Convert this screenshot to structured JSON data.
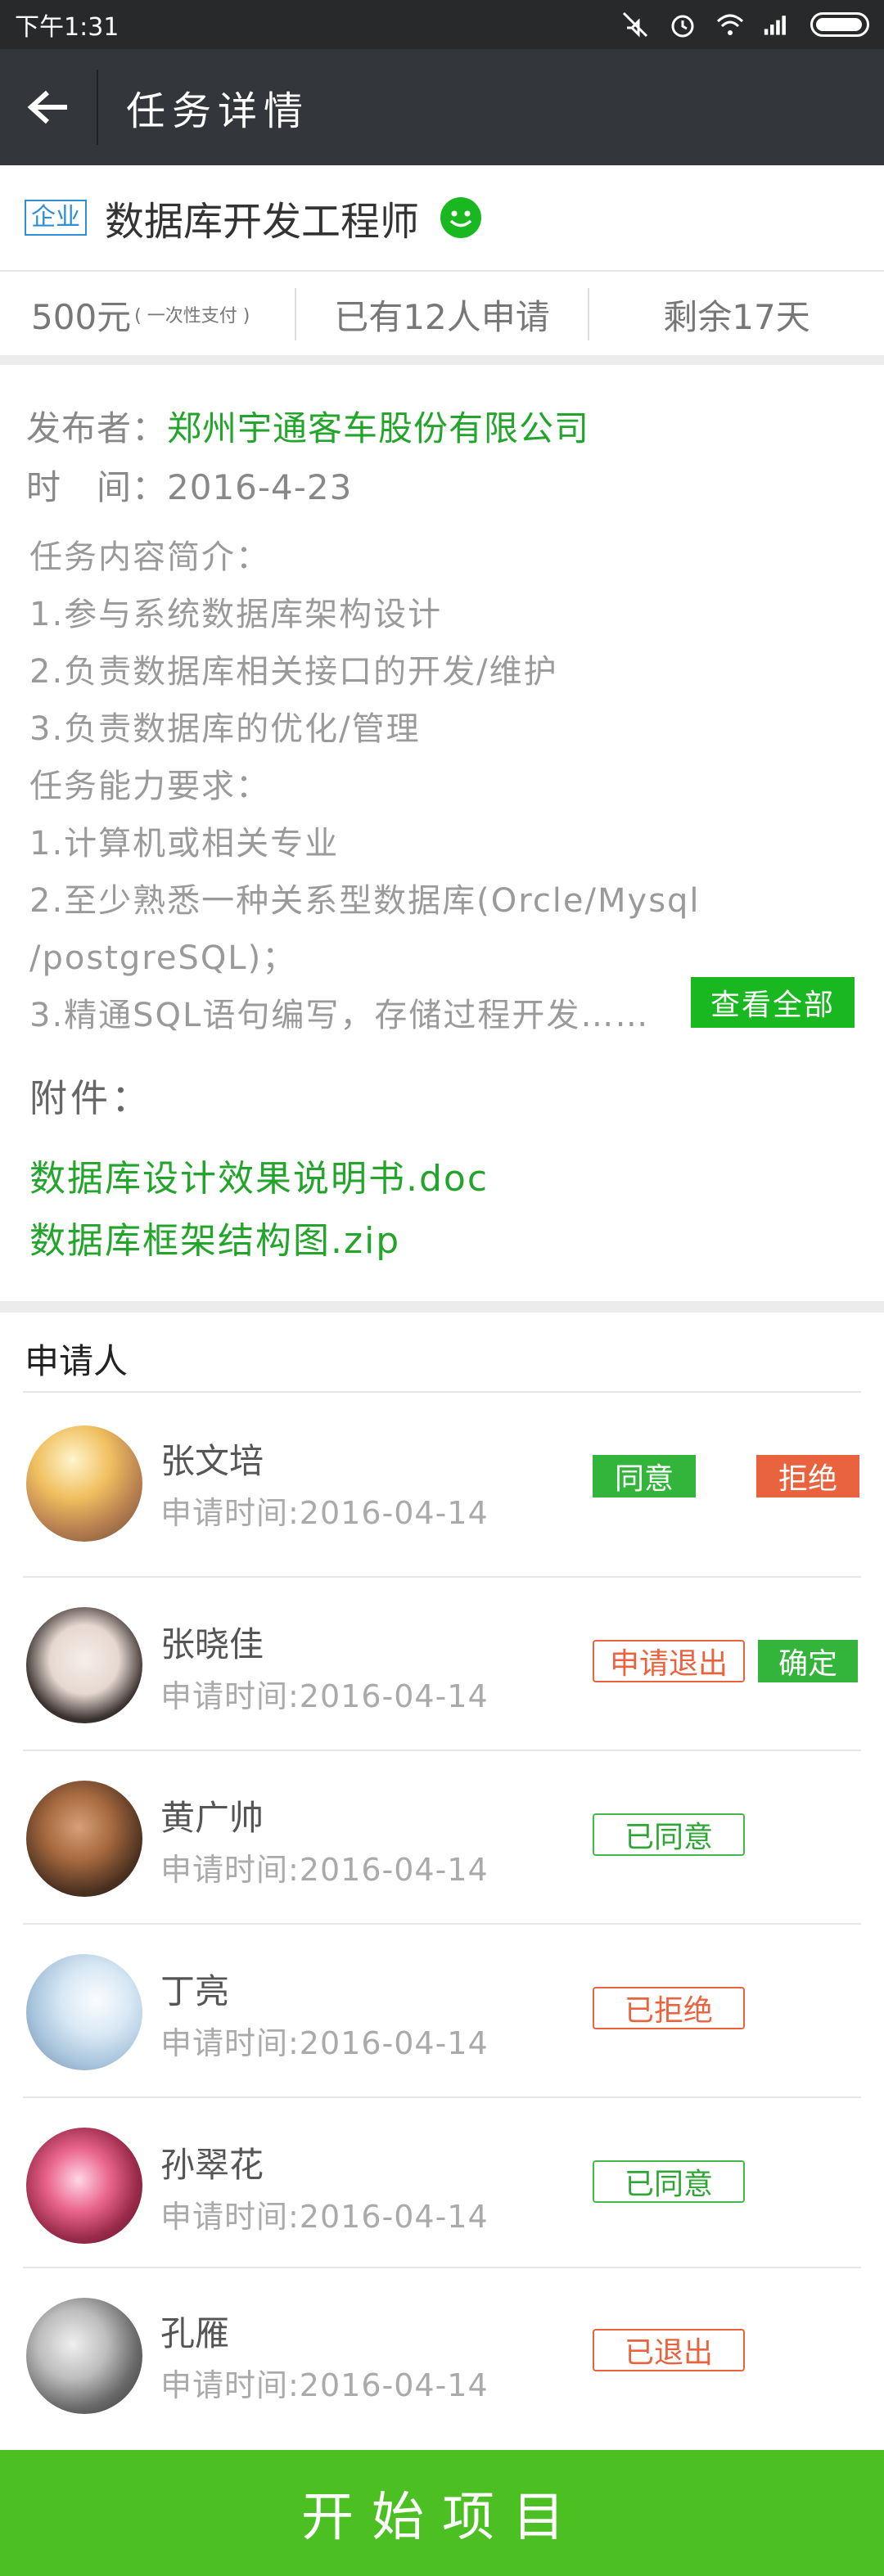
{
  "status_bar": {
    "time": "下午1:31"
  },
  "nav": {
    "title": "任务详情"
  },
  "task": {
    "badge": "企业",
    "title": "数据库开发工程师",
    "price": "500元",
    "price_note": "( 一次性支付 )",
    "applicants_count": "已有12人申请",
    "remaining": "剩余17天"
  },
  "details": {
    "publisher_label": "发布者：",
    "publisher": "郑州宇通客车股份有限公司",
    "time_label": "时　间：",
    "time": "2016-4-23",
    "lines": [
      "任务内容简介：",
      "1.参与系统数据库架构设计",
      "2.负责数据库相关接口的开发/维护",
      "3.负责数据库的优化/管理",
      "任务能力要求：",
      "1.计算机或相关专业",
      "2.至少熟悉一种关系型数据库(Orcle/Mysql",
      "/postgreSQL)；",
      "3.精通SQL语句编写，存储过程开发……"
    ],
    "view_all": "查看全部",
    "attach_title": "附件：",
    "attachments": [
      "数据库设计效果说明书.doc",
      "数据库框架结构图.zip"
    ]
  },
  "applicants_header": "申请人",
  "applicants": [
    {
      "name": "张文培",
      "time": "申请时间:2016-04-14",
      "actions": [
        "同意",
        "拒绝"
      ]
    },
    {
      "name": "张晓佳",
      "time": "申请时间:2016-04-14",
      "actions": [
        "申请退出",
        "确定"
      ]
    },
    {
      "name": "黄广帅",
      "time": "申请时间:2016-04-14",
      "actions": [
        "已同意"
      ]
    },
    {
      "name": "丁亮",
      "time": "申请时间:2016-04-14",
      "actions": [
        "已拒绝"
      ]
    },
    {
      "name": "孙翠花",
      "time": "申请时间:2016-04-14",
      "actions": [
        "已同意"
      ]
    },
    {
      "name": "孔雁",
      "time": "申请时间:2016-04-14",
      "actions": [
        "已退出"
      ]
    }
  ],
  "start_button": "开始项目",
  "icons": [
    "back-arrow-icon",
    "wechat-icon",
    "mute-icon",
    "alarm-icon",
    "wifi-icon",
    "signal-icon",
    "battery-icon"
  ]
}
